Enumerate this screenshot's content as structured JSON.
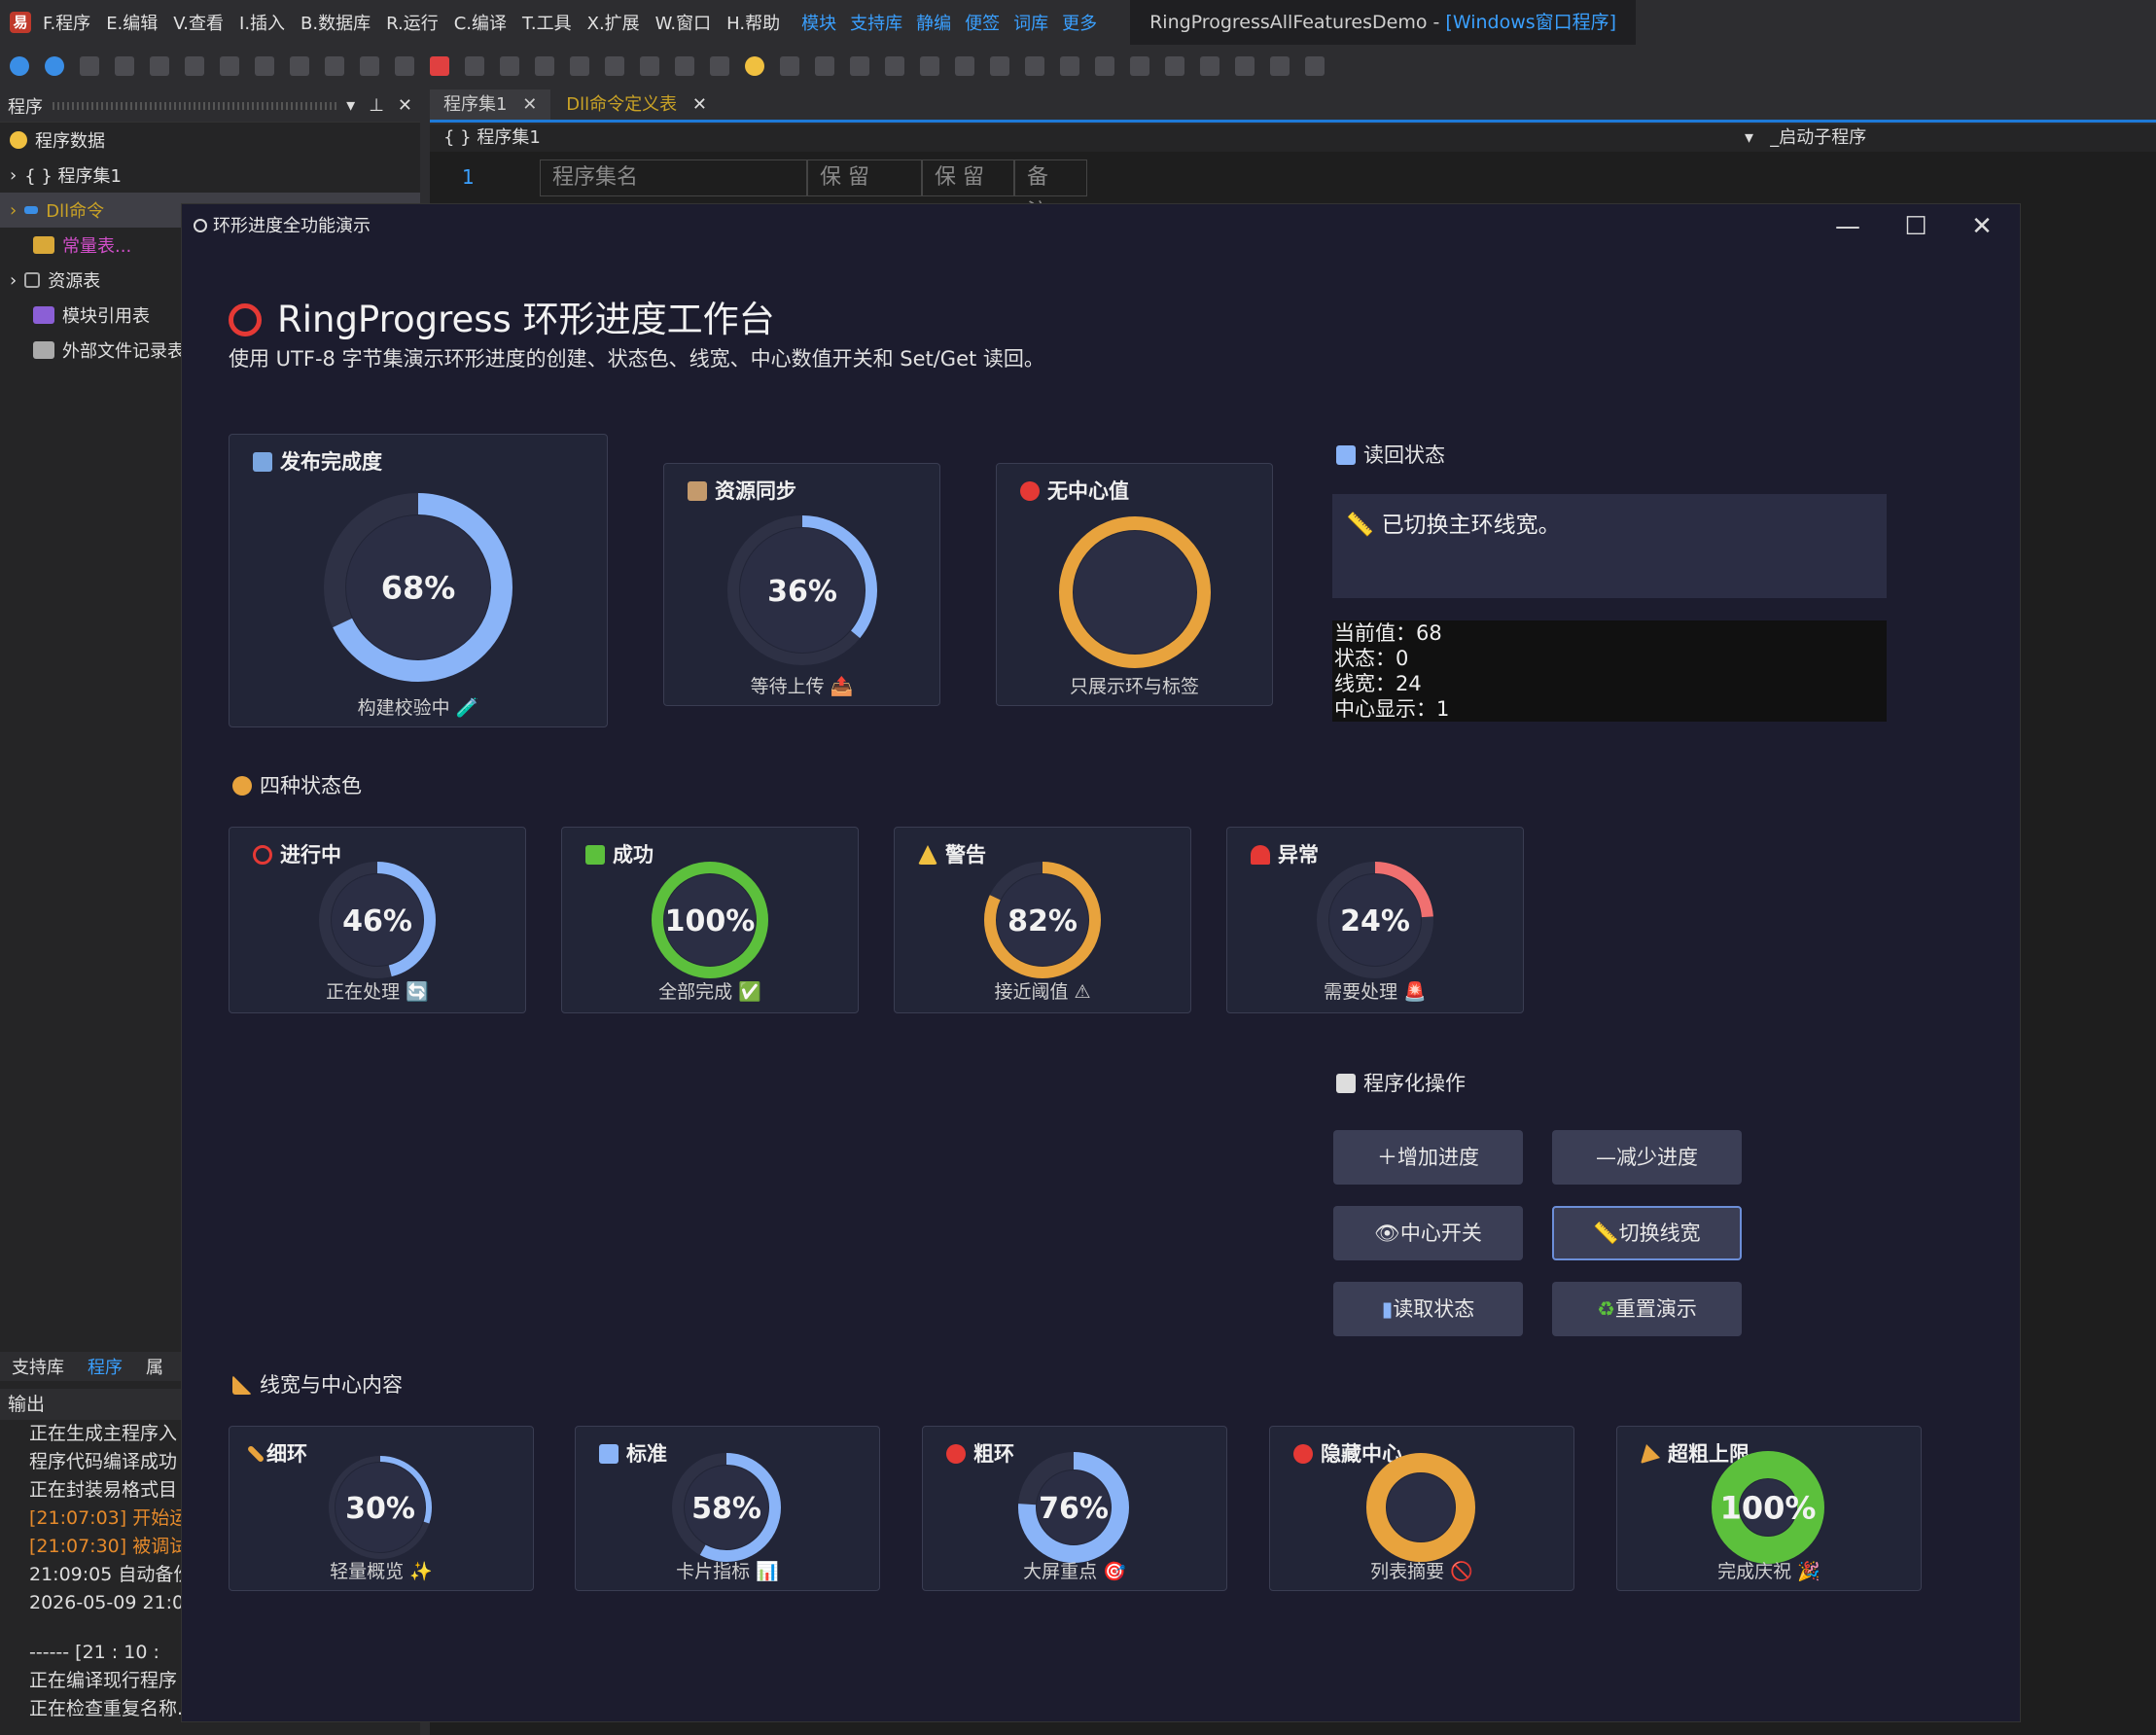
{
  "ide": {
    "menu": [
      "F.程序",
      "E.编辑",
      "V.查看",
      "I.插入",
      "B.数据库",
      "R.运行",
      "C.编译",
      "T.工具",
      "X.扩展",
      "W.窗口",
      "H.帮助"
    ],
    "menu_blue": [
      "模块",
      "支持库",
      "静编",
      "便签",
      "词库",
      "更多"
    ],
    "window_title": "RingProgressAllFeaturesDemo - ",
    "window_title_mode": "[Windows窗口程序]",
    "left_panel_title": "程序",
    "tree": [
      "程序数据",
      "{ } 程序集1",
      "Dll命令",
      "常量表...",
      "资源表",
      "模块引用表",
      "外部文件记录表"
    ],
    "bottom_tabs": [
      "支持库",
      "程序",
      "属"
    ],
    "output_title": "输出",
    "output_lines": [
      "正在生成主程序入",
      "程序代码编译成功",
      "正在封装易格式目",
      "[21:07:03] 开始运",
      "[21:07:30] 被调试",
      "21:09:05 自动备份",
      "2026-05-09 21:0"
    ],
    "output_lines2": [
      "------ [21 : 10 :",
      "正在编译现行程序",
      "正在检查重复名称..."
    ],
    "editor_tabs": [
      "程序集1",
      "Dll命令定义表"
    ],
    "editor_path": "{ } 程序集1",
    "editor_right": "_启动子程序",
    "line_no": "1",
    "grid_headers": [
      "程序集名",
      "保 留",
      "保 留",
      "备 注"
    ]
  },
  "dialog": {
    "title": "环形进度全功能演示",
    "heading": "RingProgress 环形进度工作台",
    "subtitle": "使用 UTF-8 字节集演示环形进度的创建、状态色、线宽、中心数值开关和 Set/Get 读回。",
    "top_cards": [
      {
        "title": "发布完成度",
        "value": 68,
        "label": "68%",
        "caption": "构建校验中 🧪",
        "color": "#8ab4f8",
        "show_center": true
      },
      {
        "title": "资源同步",
        "value": 36,
        "label": "36%",
        "caption": "等待上传 📤",
        "color": "#8ab4f8",
        "show_center": true
      },
      {
        "title": "无中心值",
        "value": 100,
        "label": "",
        "caption": "只展示环与标签",
        "color": "#e8a33d",
        "show_center": false
      }
    ],
    "readback_title": "读回状态",
    "readback_message": "已切换主环线宽。",
    "readback_lines": [
      "当前值：68",
      "状态：0",
      "线宽：24",
      "中心显示：1"
    ],
    "state_section_title": "四种状态色",
    "state_cards": [
      {
        "title": "进行中",
        "value": 46,
        "label": "46%",
        "caption": "正在处理 🔄",
        "color": "#8ab4f8"
      },
      {
        "title": "成功",
        "value": 100,
        "label": "100%",
        "caption": "全部完成 ✅",
        "color": "#5cc03c"
      },
      {
        "title": "警告",
        "value": 82,
        "label": "82%",
        "caption": "接近阈值 ⚠",
        "color": "#e8a33d"
      },
      {
        "title": "异常",
        "value": 24,
        "label": "24%",
        "caption": "需要处理 🚨",
        "color": "#f07070"
      }
    ],
    "ops_title": "程序化操作",
    "buttons": [
      "增加进度",
      "减少进度",
      "中心开关",
      "切换线宽",
      "读取状态",
      "重置演示"
    ],
    "width_section_title": "线宽与中心内容",
    "width_cards": [
      {
        "title": "细环",
        "value": 30,
        "label": "30%",
        "caption": "轻量概览 ✨",
        "color": "#8ab4f8",
        "stroke": "thin"
      },
      {
        "title": "标准",
        "value": 58,
        "label": "58%",
        "caption": "卡片指标 📊",
        "color": "#8ab4f8",
        "stroke": "normal"
      },
      {
        "title": "粗环",
        "value": 76,
        "label": "76%",
        "caption": "大屏重点 🎯",
        "color": "#8ab4f8",
        "stroke": "thick"
      },
      {
        "title": "隐藏中心",
        "value": 100,
        "label": "",
        "caption": "列表摘要 🚫",
        "color": "#e8a33d",
        "stroke": "thick"
      },
      {
        "title": "超粗上限",
        "value": 100,
        "label": "100%",
        "caption": "完成庆祝 🎉",
        "color": "#5cc03c",
        "stroke": "max"
      }
    ],
    "colors": {
      "accent": "#8ab4f8",
      "success": "#5cc03c",
      "warning": "#e8a33d",
      "danger": "#f07070"
    }
  }
}
